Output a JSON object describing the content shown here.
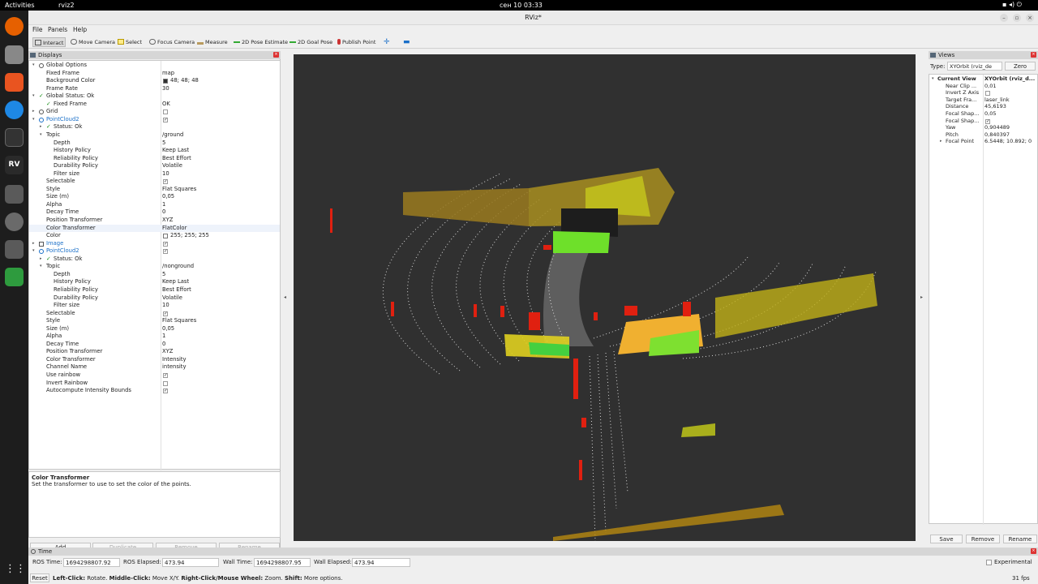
{
  "topbar": {
    "activities": "Activities",
    "app": "rviz2",
    "clock": "сен 10  03:33"
  },
  "window": {
    "title": "RViz*"
  },
  "menu": [
    "File",
    "Panels",
    "Help"
  ],
  "toolbar": [
    "Interact",
    "Move Camera",
    "Select",
    "Focus Camera",
    "Measure",
    "2D Pose Estimate",
    "2D Goal Pose",
    "Publish Point"
  ],
  "displays": {
    "title": "Displays",
    "rows": [
      {
        "i": 0,
        "a": "▾",
        "n": "Global Options",
        "v": "",
        "ic": "g"
      },
      {
        "i": 1,
        "n": "Fixed Frame",
        "v": "map"
      },
      {
        "i": 1,
        "n": "Background Color",
        "v": "48; 48; 48",
        "sw": "#303030"
      },
      {
        "i": 1,
        "n": "Frame Rate",
        "v": "30"
      },
      {
        "i": 0,
        "a": "▾",
        "n": "Global Status: Ok",
        "v": "",
        "ok": 1
      },
      {
        "i": 1,
        "n": "Fixed Frame",
        "v": "OK",
        "ok": 1
      },
      {
        "i": 0,
        "a": "▸",
        "n": "Grid",
        "v": "",
        "cb": " ",
        "ic": "g"
      },
      {
        "i": 0,
        "a": "▾",
        "n": "PointCloud2",
        "v": "",
        "cb": "✓",
        "blue": 1,
        "ic": "p"
      },
      {
        "i": 1,
        "a": "▸",
        "n": "Status: Ok",
        "v": "",
        "ok": 1
      },
      {
        "i": 1,
        "a": "▾",
        "n": "Topic",
        "v": "/ground"
      },
      {
        "i": 2,
        "n": "Depth",
        "v": "5"
      },
      {
        "i": 2,
        "n": "History Policy",
        "v": "Keep Last"
      },
      {
        "i": 2,
        "n": "Reliability Policy",
        "v": "Best Effort"
      },
      {
        "i": 2,
        "n": "Durability Policy",
        "v": "Volatile"
      },
      {
        "i": 2,
        "n": "Filter size",
        "v": "10"
      },
      {
        "i": 1,
        "n": "Selectable",
        "v": "",
        "cb": "✓"
      },
      {
        "i": 1,
        "n": "Style",
        "v": "Flat Squares"
      },
      {
        "i": 1,
        "n": "Size (m)",
        "v": "0,05"
      },
      {
        "i": 1,
        "n": "Alpha",
        "v": "1"
      },
      {
        "i": 1,
        "n": "Decay Time",
        "v": "0"
      },
      {
        "i": 1,
        "n": "Position Transformer",
        "v": "XYZ"
      },
      {
        "i": 1,
        "n": "Color Transformer",
        "v": "FlatColor",
        "sel": 1
      },
      {
        "i": 1,
        "n": "Color",
        "v": "255; 255; 255",
        "sw": "#ffffff"
      },
      {
        "i": 0,
        "a": "▸",
        "n": "Image",
        "v": "",
        "cb": "✓",
        "blue": 1,
        "ic": "i"
      },
      {
        "i": 0,
        "a": "▾",
        "n": "PointCloud2",
        "v": "",
        "cb": "✓",
        "blue": 1,
        "ic": "p"
      },
      {
        "i": 1,
        "a": "▸",
        "n": "Status: Ok",
        "v": "",
        "ok": 1
      },
      {
        "i": 1,
        "a": "▾",
        "n": "Topic",
        "v": "/nonground"
      },
      {
        "i": 2,
        "n": "Depth",
        "v": "5"
      },
      {
        "i": 2,
        "n": "History Policy",
        "v": "Keep Last"
      },
      {
        "i": 2,
        "n": "Reliability Policy",
        "v": "Best Effort"
      },
      {
        "i": 2,
        "n": "Durability Policy",
        "v": "Volatile"
      },
      {
        "i": 2,
        "n": "Filter size",
        "v": "10"
      },
      {
        "i": 1,
        "n": "Selectable",
        "v": "",
        "cb": "✓"
      },
      {
        "i": 1,
        "n": "Style",
        "v": "Flat Squares"
      },
      {
        "i": 1,
        "n": "Size (m)",
        "v": "0,05"
      },
      {
        "i": 1,
        "n": "Alpha",
        "v": "1"
      },
      {
        "i": 1,
        "n": "Decay Time",
        "v": "0"
      },
      {
        "i": 1,
        "n": "Position Transformer",
        "v": "XYZ"
      },
      {
        "i": 1,
        "n": "Color Transformer",
        "v": "Intensity"
      },
      {
        "i": 1,
        "n": "Channel Name",
        "v": "intensity"
      },
      {
        "i": 1,
        "n": "Use rainbow",
        "v": "",
        "cb": "✓"
      },
      {
        "i": 1,
        "n": "Invert Rainbow",
        "v": "",
        "cb": " "
      },
      {
        "i": 1,
        "n": "Autocompute Intensity Bounds",
        "v": "",
        "cb": "✓"
      }
    ],
    "desc_title": "Color Transformer",
    "desc_text": "Set the transformer to use to set the color of the points.",
    "buttons": [
      "Add",
      "Duplicate",
      "Remove",
      "Rename"
    ]
  },
  "views": {
    "title": "Views",
    "type_label": "Type:",
    "type_value": "XYOrbit (rviz_de",
    "zero": "Zero",
    "rows": [
      {
        "n": "Current View",
        "v": "XYOrbit (rviz_d...",
        "b": 1,
        "a": "▾"
      },
      {
        "n": "Near Clip ...",
        "v": "0,01"
      },
      {
        "n": "Invert Z Axis",
        "v": "",
        "cb": " "
      },
      {
        "n": "Target Fra...",
        "v": "laser_link"
      },
      {
        "n": "Distance",
        "v": "45,6193"
      },
      {
        "n": "Focal Shap...",
        "v": "0,05"
      },
      {
        "n": "Focal Shap...",
        "v": "",
        "cb": "✓"
      },
      {
        "n": "Yaw",
        "v": "0,904489"
      },
      {
        "n": "Pitch",
        "v": "0,840397"
      },
      {
        "n": "Focal Point",
        "v": "6.5448; 10.892; 0",
        "a": "▸"
      }
    ],
    "buttons": [
      "Save",
      "Remove",
      "Rename"
    ]
  },
  "time": {
    "title": "Time",
    "ros_time_l": "ROS Time:",
    "ros_time": "1694298807.92",
    "ros_el_l": "ROS Elapsed:",
    "ros_el": "473.94",
    "wall_time_l": "Wall Time:",
    "wall_time": "1694298807.95",
    "wall_el_l": "Wall Elapsed:",
    "wall_el": "473.94",
    "experimental": "Experimental",
    "reset": "Reset",
    "hint_parts": [
      "Left-Click:",
      " Rotate. ",
      "Middle-Click:",
      " Move X/Y. ",
      "Right-Click/Mouse Wheel:",
      " Zoom. ",
      "Shift:",
      " More options."
    ],
    "fps": "31 fps"
  }
}
